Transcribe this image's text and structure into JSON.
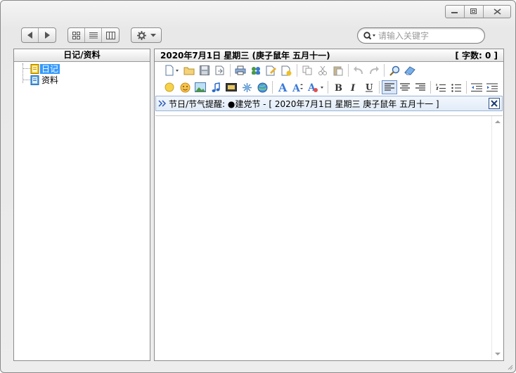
{
  "window": {
    "controls": [
      "minimize",
      "restore",
      "close"
    ]
  },
  "search": {
    "placeholder": "请输入关键字"
  },
  "left_panel": {
    "title": "日记/资料",
    "items": [
      {
        "label": "日记",
        "selected": true
      },
      {
        "label": "资料",
        "selected": false
      }
    ]
  },
  "right_panel": {
    "date_header": "2020年7月1日  星期三 (庚子鼠年 五月十一)",
    "word_count": "[ 字数: 0 ]",
    "reminder": "节日/节气提醒: ●建党节 - [ 2020年7月1日  星期三  庚子鼠年 五月十一 ]"
  },
  "colors": {
    "accent": "#3399ff",
    "reminder_bg": "#e8f0fa",
    "close_border": "#2d4f86"
  }
}
